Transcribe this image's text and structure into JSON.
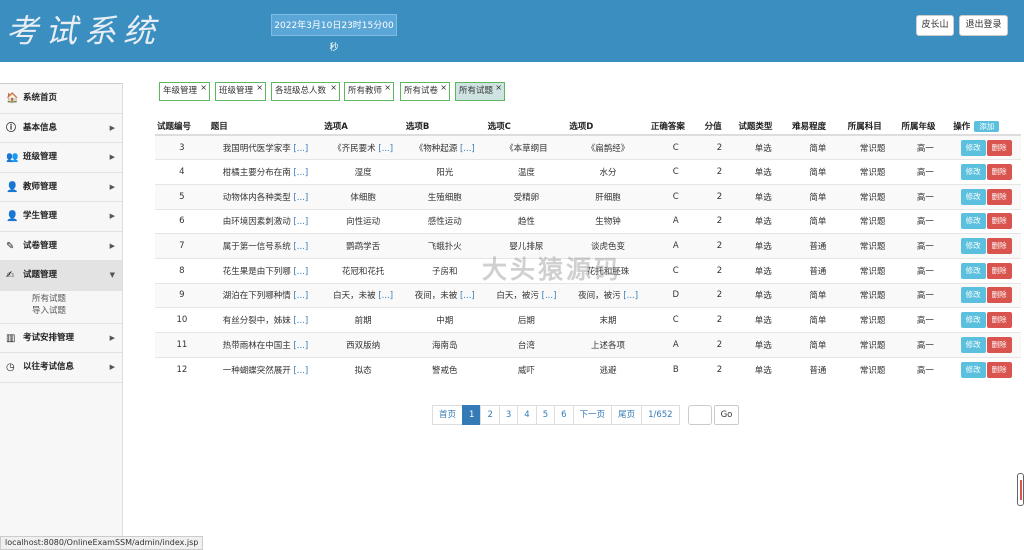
{
  "header": {
    "logo": "考试系统",
    "datetime": "2022年3月10日23时15分00秒",
    "user": "皮长山",
    "logout": "退出登录"
  },
  "sidebar": {
    "items": [
      {
        "icon": "home-icon",
        "glyph": "🏠",
        "label": "系统首页"
      },
      {
        "icon": "info-icon",
        "glyph": "ⓘ",
        "label": "基本信息"
      },
      {
        "icon": "class-icon",
        "glyph": "👥",
        "label": "班级管理"
      },
      {
        "icon": "teacher-icon",
        "glyph": "👤",
        "label": "教师管理"
      },
      {
        "icon": "student-icon",
        "glyph": "👤",
        "label": "学生管理"
      },
      {
        "icon": "paper-icon",
        "glyph": "✎",
        "label": "试卷管理"
      },
      {
        "icon": "question-icon",
        "glyph": "✍",
        "label": "试题管理"
      },
      {
        "icon": "schedule-icon",
        "glyph": "▥",
        "label": "考试安排管理"
      },
      {
        "icon": "history-icon",
        "glyph": "◷",
        "label": "以往考试信息"
      }
    ],
    "subitems": [
      "所有试题",
      "导入试题"
    ]
  },
  "tabs": [
    "年级管理",
    "班级管理",
    "各班级总人数",
    "所有教师",
    "所有试卷",
    "所有试题"
  ],
  "table": {
    "headers": [
      "试题编号",
      "题目",
      "选项A",
      "选项B",
      "选项C",
      "选项D",
      "正确答案",
      "分值",
      "试题类型",
      "难易程度",
      "所属科目",
      "所属年级",
      "操作"
    ],
    "add_label": "添加",
    "edit_label": "修改",
    "delete_label": "删除",
    "dots": "[...]",
    "rows": [
      {
        "id": "3",
        "q": "我国明代医学家李",
        "a": "《齐民要术",
        "b": "《物种起源",
        "c": "《本草纲目",
        "d": "《扁鹊经》",
        "ans": "C",
        "score": "2",
        "type": "单选",
        "level": "简单",
        "subject": "常识题",
        "grade": "高一",
        "dots": [
          1,
          1,
          1,
          0,
          0
        ]
      },
      {
        "id": "4",
        "q": "柑橘主要分布在南",
        "a": "湿度",
        "b": "阳光",
        "c": "温度",
        "d": "水分",
        "ans": "C",
        "score": "2",
        "type": "单选",
        "level": "简单",
        "subject": "常识题",
        "grade": "高一",
        "dots": [
          1,
          0,
          0,
          0,
          0
        ]
      },
      {
        "id": "5",
        "q": "动物体内各种类型",
        "a": "体细胞",
        "b": "生殖细胞",
        "c": "受精卵",
        "d": "肝细胞",
        "ans": "C",
        "score": "2",
        "type": "单选",
        "level": "简单",
        "subject": "常识题",
        "grade": "高一",
        "dots": [
          1,
          0,
          0,
          0,
          0
        ]
      },
      {
        "id": "6",
        "q": "由环境因素刺激动",
        "a": "向性运动",
        "b": "感性运动",
        "c": "趋性",
        "d": "生物钟",
        "ans": "A",
        "score": "2",
        "type": "单选",
        "level": "简单",
        "subject": "常识题",
        "grade": "高一",
        "dots": [
          1,
          0,
          0,
          0,
          0
        ]
      },
      {
        "id": "7",
        "q": "属于第一信号系统",
        "a": "鹦鹉学舌",
        "b": "飞蛾扑火",
        "c": "婴儿排尿",
        "d": "谈虎色变",
        "ans": "A",
        "score": "2",
        "type": "单选",
        "level": "普通",
        "subject": "常识题",
        "grade": "高一",
        "dots": [
          1,
          0,
          0,
          0,
          0
        ]
      },
      {
        "id": "8",
        "q": "花生果是由下列哪",
        "a": "花冠和花托",
        "b": "子房和",
        "c": "",
        "d": "花托和胚珠",
        "ans": "C",
        "score": "2",
        "type": "单选",
        "level": "普通",
        "subject": "常识题",
        "grade": "高一",
        "dots": [
          1,
          0,
          0,
          0,
          0
        ]
      },
      {
        "id": "9",
        "q": "湖泊在下列哪种情",
        "a": "白天，未被",
        "b": "夜间，未被",
        "c": "白天，被污",
        "d": "夜间，被污",
        "ans": "D",
        "score": "2",
        "type": "单选",
        "level": "简单",
        "subject": "常识题",
        "grade": "高一",
        "dots": [
          1,
          1,
          1,
          1,
          1
        ]
      },
      {
        "id": "10",
        "q": "有丝分裂中，姊妹",
        "a": "前期",
        "b": "中期",
        "c": "后期",
        "d": "末期",
        "ans": "C",
        "score": "2",
        "type": "单选",
        "level": "简单",
        "subject": "常识题",
        "grade": "高一",
        "dots": [
          1,
          0,
          0,
          0,
          0
        ]
      },
      {
        "id": "11",
        "q": "热带雨林在中国主",
        "a": "西双版纳",
        "b": "海南岛",
        "c": "台湾",
        "d": "上述各项",
        "ans": "A",
        "score": "2",
        "type": "单选",
        "level": "简单",
        "subject": "常识题",
        "grade": "高一",
        "dots": [
          1,
          0,
          0,
          0,
          0
        ]
      },
      {
        "id": "12",
        "q": "一种蝴蝶突然展开",
        "a": "拟态",
        "b": "警戒色",
        "c": "威吓",
        "d": "逃避",
        "ans": "B",
        "score": "2",
        "type": "单选",
        "level": "普通",
        "subject": "常识题",
        "grade": "高一",
        "dots": [
          1,
          0,
          0,
          0,
          0
        ]
      }
    ]
  },
  "pager": {
    "first": "首页",
    "pages": [
      "1",
      "2",
      "3",
      "4",
      "5",
      "6"
    ],
    "current": "1",
    "next": "下一页",
    "last": "尾页",
    "info": "1/652",
    "go": "Go"
  },
  "watermark": "大头猿源码",
  "statusbar": "localhost:8080/OnlineExamSSM/admin/index.jsp"
}
